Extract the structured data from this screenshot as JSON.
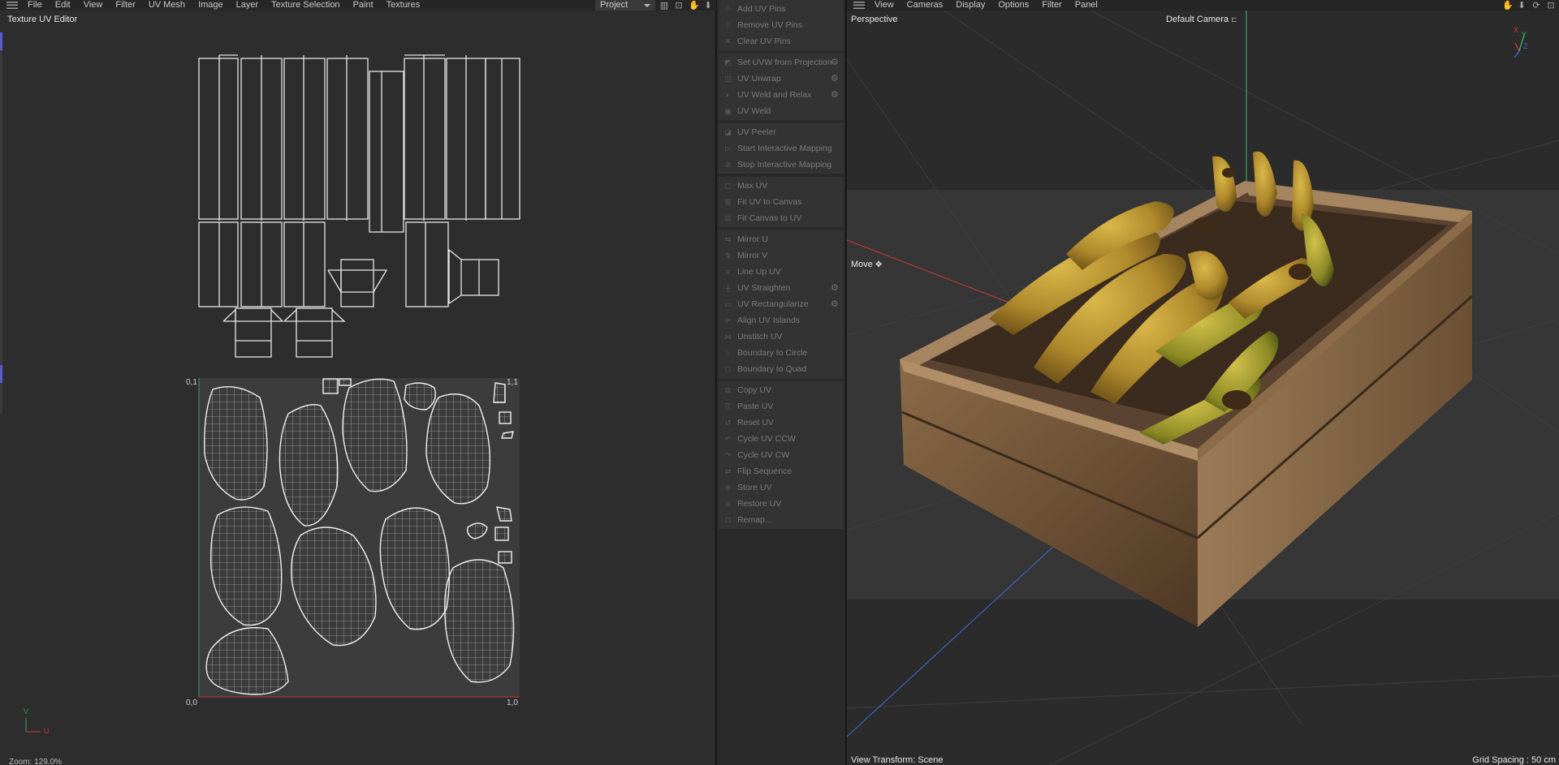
{
  "uv_editor": {
    "menu": [
      "File",
      "Edit",
      "View",
      "Filter",
      "UV Mesh",
      "Image",
      "Layer",
      "Texture Selection",
      "Paint",
      "Textures"
    ],
    "project_select": "Project",
    "title": "Texture UV Editor",
    "corner_labels": {
      "top_left": "0,1",
      "top_right": "1,1",
      "bottom_left": "0,0",
      "bottom_right": "1,0"
    },
    "axis_v": "V",
    "axis_u": "U",
    "zoom": "Zoom: 129.0%",
    "axis_colors": {
      "u": "#c83232",
      "v": "#2f9e6a"
    }
  },
  "uv_commands": {
    "groups": [
      [
        {
          "label": "Add UV Pins",
          "icon": "pin-add-icon"
        },
        {
          "label": "Remove UV Pins",
          "icon": "pin-remove-icon"
        },
        {
          "label": "Clear UV Pins",
          "icon": "clear-pins-icon"
        }
      ],
      [
        {
          "label": "Set UVW from Projection",
          "icon": "projection-icon",
          "gear": true
        },
        {
          "label": "UV Unwrap",
          "icon": "unwrap-icon",
          "gear": true
        },
        {
          "label": "UV Weld and Relax",
          "icon": "weld-relax-icon",
          "gear": true
        },
        {
          "label": "UV Weld",
          "icon": "weld-icon"
        }
      ],
      [
        {
          "label": "UV Peeler",
          "icon": "peeler-icon"
        },
        {
          "label": "Start Interactive Mapping",
          "icon": "play-icon"
        },
        {
          "label": "Stop Interactive Mapping",
          "icon": "stop-icon"
        }
      ],
      [
        {
          "label": "Max UV",
          "icon": "max-uv-icon"
        },
        {
          "label": "Fit UV to Canvas",
          "icon": "fit-uv-icon"
        },
        {
          "label": "Fit Canvas to UV",
          "icon": "fit-canvas-icon"
        }
      ],
      [
        {
          "label": "Mirror U",
          "icon": "mirror-u-icon"
        },
        {
          "label": "Mirror V",
          "icon": "mirror-v-icon"
        },
        {
          "label": "Line Up UV",
          "icon": "line-up-icon"
        },
        {
          "label": "UV Straighten",
          "icon": "straighten-icon",
          "gear": true
        },
        {
          "label": "UV Rectangularize",
          "icon": "rectangularize-icon",
          "gear": true
        },
        {
          "label": "Align UV Islands",
          "icon": "align-icon"
        },
        {
          "label": "Unstitch UV",
          "icon": "unstitch-icon"
        },
        {
          "label": "Boundary to Circle",
          "icon": "circle-icon"
        },
        {
          "label": "Boundary to Quad",
          "icon": "quad-icon"
        }
      ],
      [
        {
          "label": "Copy UV",
          "icon": "copy-icon"
        },
        {
          "label": "Paste UV",
          "icon": "paste-icon"
        },
        {
          "label": "Reset UV",
          "icon": "reset-icon"
        },
        {
          "label": "Cycle UV CCW",
          "icon": "cycle-ccw-icon"
        },
        {
          "label": "Cycle UV CW",
          "icon": "cycle-cw-icon"
        },
        {
          "label": "Flip Sequence",
          "icon": "flip-icon"
        },
        {
          "label": "Store UV",
          "icon": "store-icon"
        },
        {
          "label": "Restore UV",
          "icon": "restore-icon"
        },
        {
          "label": "Remap...",
          "icon": "remap-icon"
        }
      ]
    ]
  },
  "viewport": {
    "menu": [
      "View",
      "Cameras",
      "Display",
      "Options",
      "Filter",
      "Panel"
    ],
    "mode": "Perspective",
    "camera": "Default Camera",
    "tool": "Move",
    "view_transform": "View Transform: Scene",
    "grid_spacing": "Grid Spacing : 50 cm",
    "gizmo": {
      "x": "X",
      "y": "Y",
      "z": "Z"
    },
    "axis_colors": {
      "x": "#d23b3b",
      "y": "#3bbf6a",
      "z": "#3a6fd6"
    }
  }
}
